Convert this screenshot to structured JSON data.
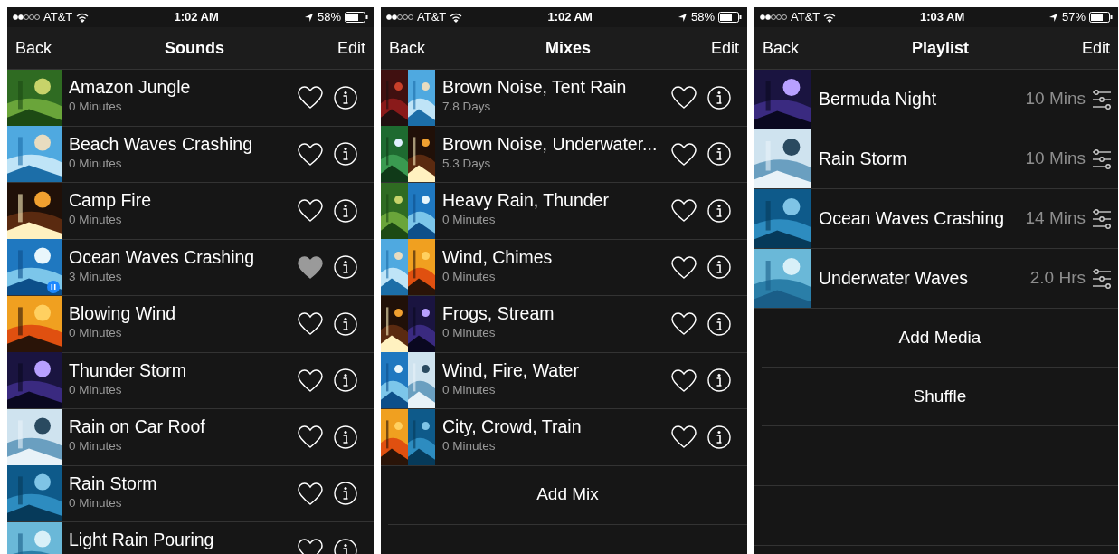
{
  "screens": [
    {
      "status": {
        "carrier": "AT&T",
        "time": "1:02 AM",
        "battery": "58%"
      },
      "nav": {
        "back": "Back",
        "title": "Sounds",
        "edit": "Edit"
      },
      "rows": [
        {
          "kind": "sound",
          "title": "Amazon Jungle",
          "subtitle": "0 Minutes",
          "favorite": false,
          "playing": false
        },
        {
          "kind": "sound",
          "title": "Beach Waves Crashing",
          "subtitle": "0 Minutes",
          "favorite": false,
          "playing": false
        },
        {
          "kind": "sound",
          "title": "Camp Fire",
          "subtitle": "0 Minutes",
          "favorite": false,
          "playing": false
        },
        {
          "kind": "sound",
          "title": "Ocean Waves Crashing",
          "subtitle": "3 Minutes",
          "favorite": true,
          "playing": true
        },
        {
          "kind": "sound",
          "title": "Blowing Wind",
          "subtitle": "0 Minutes",
          "favorite": false,
          "playing": false
        },
        {
          "kind": "sound",
          "title": "Thunder Storm",
          "subtitle": "0 Minutes",
          "favorite": false,
          "playing": false
        },
        {
          "kind": "sound",
          "title": "Rain on Car Roof",
          "subtitle": "0 Minutes",
          "favorite": false,
          "playing": false
        },
        {
          "kind": "sound",
          "title": "Rain Storm",
          "subtitle": "0 Minutes",
          "favorite": false,
          "playing": false
        },
        {
          "kind": "sound",
          "title": "Light Rain Pouring",
          "favorite": false,
          "playing": false
        }
      ]
    },
    {
      "status": {
        "carrier": "AT&T",
        "time": "1:02 AM",
        "battery": "58%"
      },
      "nav": {
        "back": "Back",
        "title": "Mixes",
        "edit": "Edit"
      },
      "rows": [
        {
          "kind": "mix",
          "title": "Brown Noise, Tent Rain",
          "subtitle": "7.8 Days",
          "favorite": false
        },
        {
          "kind": "mix",
          "title": "Brown Noise, Underwater...",
          "subtitle": "5.3 Days",
          "favorite": false
        },
        {
          "kind": "mix",
          "title": "Heavy Rain, Thunder",
          "subtitle": "0 Minutes",
          "favorite": false
        },
        {
          "kind": "mix",
          "title": "Wind, Chimes",
          "subtitle": "0 Minutes",
          "favorite": false
        },
        {
          "kind": "mix",
          "title": "Frogs, Stream",
          "subtitle": "0 Minutes",
          "favorite": false
        },
        {
          "kind": "mix",
          "title": "Wind, Fire, Water",
          "subtitle": "0 Minutes",
          "favorite": false
        },
        {
          "kind": "mix",
          "title": "City, Crowd, Train",
          "subtitle": "0 Minutes",
          "favorite": false
        }
      ],
      "actions": [
        "Add Mix"
      ]
    },
    {
      "status": {
        "carrier": "AT&T",
        "time": "1:03 AM",
        "battery": "57%"
      },
      "nav": {
        "back": "Back",
        "title": "Playlist",
        "edit": "Edit"
      },
      "rows": [
        {
          "kind": "track",
          "title": "Bermuda Night",
          "duration": "10 Mins"
        },
        {
          "kind": "track",
          "title": "Rain Storm",
          "duration": "10 Mins"
        },
        {
          "kind": "track",
          "title": "Ocean Waves Crashing",
          "duration": "14 Mins"
        },
        {
          "kind": "track",
          "title": "Underwater Waves",
          "duration": "2.0 Hrs"
        }
      ],
      "actions": [
        "Add Media",
        "Shuffle"
      ]
    }
  ]
}
